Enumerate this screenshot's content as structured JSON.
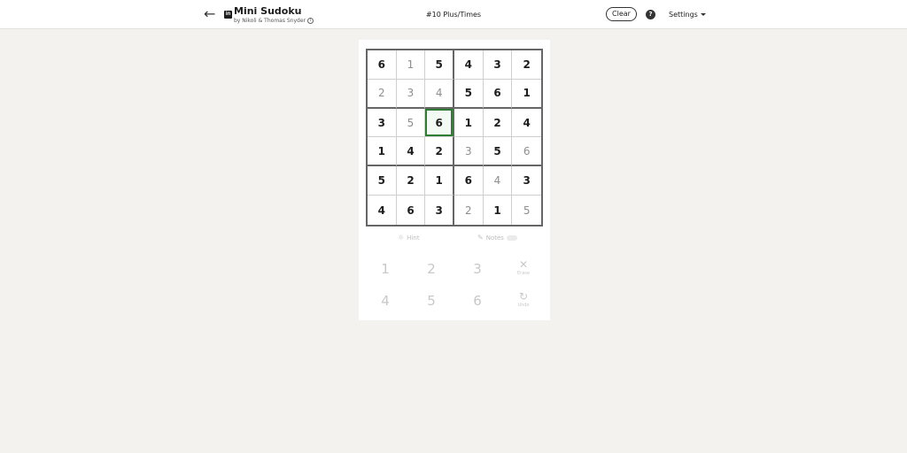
{
  "header": {
    "app_title": "Mini Sudoku",
    "byline": "by Nikoli & Thomas Snyder",
    "puzzle_title": "#10 Plus/Times",
    "clear_label": "Clear",
    "help_symbol": "?",
    "settings_label": "Settings",
    "logo_text": "in"
  },
  "board": {
    "selected": [
      2,
      2
    ],
    "selected_color": "#2e7d32",
    "rows": [
      [
        {
          "v": "6",
          "given": true
        },
        {
          "v": "1",
          "given": false
        },
        {
          "v": "5",
          "given": true
        },
        {
          "v": "4",
          "given": true
        },
        {
          "v": "3",
          "given": true
        },
        {
          "v": "2",
          "given": true
        }
      ],
      [
        {
          "v": "2",
          "given": false
        },
        {
          "v": "3",
          "given": false
        },
        {
          "v": "4",
          "given": false
        },
        {
          "v": "5",
          "given": true
        },
        {
          "v": "6",
          "given": true
        },
        {
          "v": "1",
          "given": true
        }
      ],
      [
        {
          "v": "3",
          "given": true
        },
        {
          "v": "5",
          "given": false
        },
        {
          "v": "6",
          "given": true
        },
        {
          "v": "1",
          "given": true
        },
        {
          "v": "2",
          "given": true
        },
        {
          "v": "4",
          "given": true
        }
      ],
      [
        {
          "v": "1",
          "given": true
        },
        {
          "v": "4",
          "given": true
        },
        {
          "v": "2",
          "given": true
        },
        {
          "v": "3",
          "given": false
        },
        {
          "v": "5",
          "given": true
        },
        {
          "v": "6",
          "given": false
        }
      ],
      [
        {
          "v": "5",
          "given": true
        },
        {
          "v": "2",
          "given": true
        },
        {
          "v": "1",
          "given": true
        },
        {
          "v": "6",
          "given": true
        },
        {
          "v": "4",
          "given": false
        },
        {
          "v": "3",
          "given": true
        }
      ],
      [
        {
          "v": "4",
          "given": true
        },
        {
          "v": "6",
          "given": true
        },
        {
          "v": "3",
          "given": true
        },
        {
          "v": "2",
          "given": false
        },
        {
          "v": "1",
          "given": true
        },
        {
          "v": "5",
          "given": false
        }
      ]
    ]
  },
  "tools": {
    "hint_label": "Hint",
    "notes_label": "Notes"
  },
  "keypad": {
    "keys": [
      "1",
      "2",
      "3",
      "4",
      "5",
      "6"
    ],
    "erase_label": "Erase",
    "undo_label": "Undo"
  }
}
